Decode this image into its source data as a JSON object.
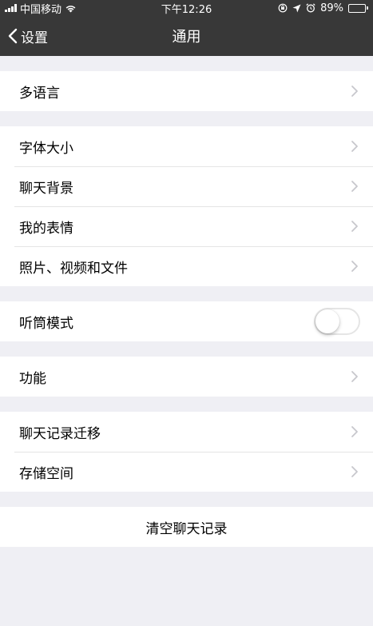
{
  "status_bar": {
    "carrier": "中国移动",
    "time": "下午12:26",
    "battery_percent": "89%",
    "battery_level": 0.89,
    "icons": [
      "signal-icon",
      "wifi-icon",
      "lock-rotation-icon",
      "location-icon",
      "alarm-icon",
      "battery-icon"
    ]
  },
  "nav": {
    "back_label": "设置",
    "title": "通用"
  },
  "groups": [
    {
      "items": [
        {
          "label": "多语言"
        }
      ]
    },
    {
      "items": [
        {
          "label": "字体大小"
        },
        {
          "label": "聊天背景"
        },
        {
          "label": "我的表情"
        },
        {
          "label": "照片、视频和文件"
        }
      ]
    },
    {
      "items": [
        {
          "label": "听筒模式",
          "toggle": false
        }
      ]
    },
    {
      "items": [
        {
          "label": "功能"
        }
      ]
    },
    {
      "items": [
        {
          "label": "聊天记录迁移"
        },
        {
          "label": "存储空间"
        }
      ]
    }
  ],
  "clear_history_label": "清空聊天记录",
  "colors": {
    "bar_background": "#383838",
    "page_background": "#efeff4",
    "separator": "#e5e5e5",
    "chevron": "#c7c7cc"
  }
}
